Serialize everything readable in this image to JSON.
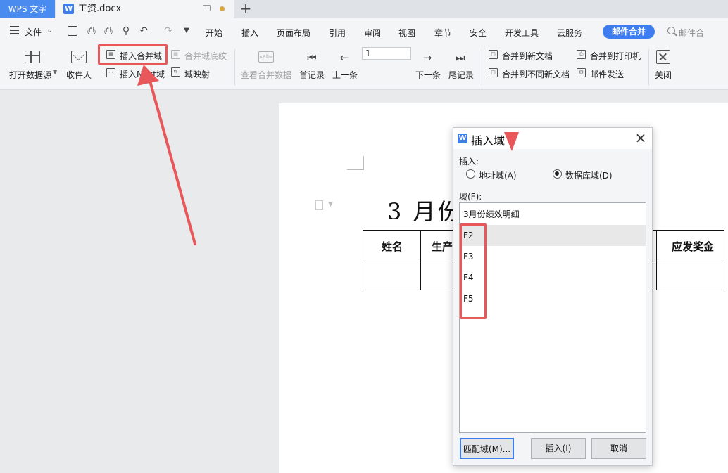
{
  "titlebar": {
    "app_tab": "WPS 文字",
    "doc_tab": "工资.docx",
    "doc_icon": "W",
    "new_tab": "+"
  },
  "menu": {
    "file_label": "文件",
    "tabs": [
      "开始",
      "插入",
      "页面布局",
      "引用",
      "审阅",
      "视图",
      "章节",
      "安全",
      "开发工具",
      "云服务"
    ],
    "active_tab": "邮件合并",
    "search_text": "邮件合"
  },
  "ribbon": {
    "open_datasource": "打开数据源",
    "recipients": "收件人",
    "insert_merge_field": "插入合并域",
    "merge_field_shading": "合并域底纹",
    "insert_next_field": "插入Next域",
    "field_mapping": "域映射",
    "view_merged_data": "查看合并数据",
    "first_record": "首记录",
    "prev_record": "上一条",
    "record_number": "1",
    "next_record": "下一条",
    "last_record": "尾记录",
    "merge_new_doc": "合并到新文档",
    "merge_diff_docs": "合并到不同新文档",
    "merge_printer": "合并到打印机",
    "mail_send": "邮件发送",
    "close": "关闭"
  },
  "document": {
    "heading": "3 月份",
    "table_headers": [
      "姓名",
      "生产",
      "应发奖金"
    ]
  },
  "dialog": {
    "icon": "W",
    "title": "插入域",
    "close": "×",
    "insert_label": "插入:",
    "radio_address": "地址域(A)",
    "radio_database": "数据库域(D)",
    "selected_radio": "数据库域(D)",
    "fields_label": "域(F):",
    "fields": [
      "3月份绩效明细",
      "F2",
      "F3",
      "F4",
      "F5"
    ],
    "match_button": "匹配域(M)...",
    "insert_button": "插入(I)",
    "cancel_button": "取消"
  },
  "colors": {
    "accent": "#3d7df0",
    "annotation_red": "#e8585a"
  }
}
